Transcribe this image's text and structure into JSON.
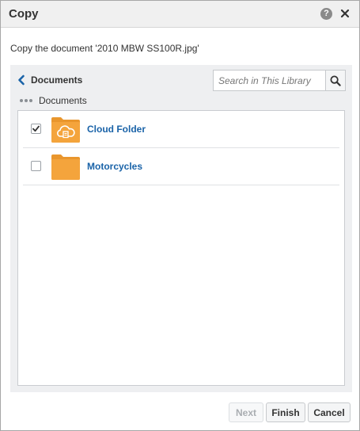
{
  "dialog": {
    "title": "Copy",
    "help_icon": "question-icon",
    "help_glyph": "?",
    "close_icon": "close-icon",
    "prompt": "Copy the document '2010 MBW SS100R.jpg'"
  },
  "navigator": {
    "back_label": "Documents",
    "search": {
      "placeholder": "Search in This Library",
      "value": ""
    },
    "breadcrumb": {
      "current": "Documents"
    }
  },
  "folders": [
    {
      "name": "Cloud Folder",
      "checked": true,
      "icon": "cloud-folder-icon"
    },
    {
      "name": "Motorcycles",
      "checked": false,
      "icon": "folder-icon"
    }
  ],
  "footer": {
    "next_label": "Next",
    "next_disabled": true,
    "finish_label": "Finish",
    "cancel_label": "Cancel"
  },
  "colors": {
    "folder": "#f4a43c",
    "folder_dark": "#e9962d",
    "link": "#1a63a8",
    "chevron": "#1a63a8",
    "panel": "#eeeff1"
  }
}
